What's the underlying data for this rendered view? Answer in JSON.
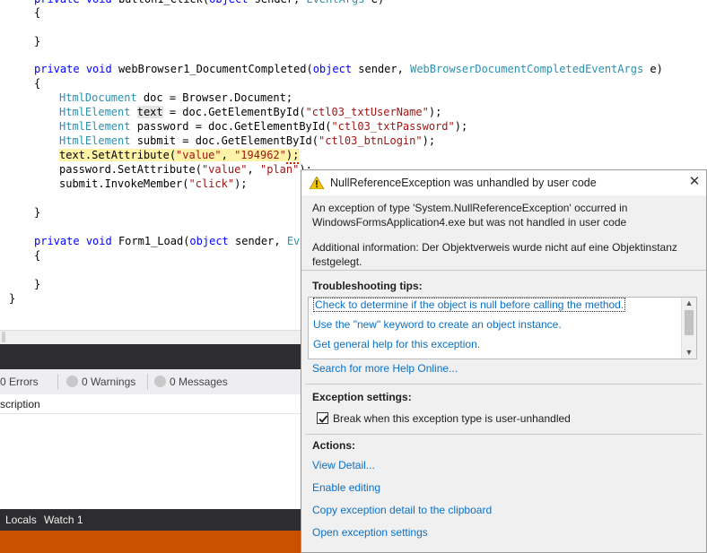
{
  "code": {
    "l1": "private void button1_Click(object sender, EventArgs e)",
    "l2": "{",
    "l3": "}",
    "m_private": "private",
    "m_void": "void",
    "m_name": "webBrowser1_DocumentCompleted(",
    "m_object": "object",
    "m_sender": " sender, ",
    "m_type": "WebBrowserDocumentCompletedEventArgs",
    "m_tail": " e)",
    "open": "{",
    "htmldoc_type": "HtmlDocument",
    "htmldoc_rest": " doc = Browser.Document;",
    "el_type": "HtmlElement",
    "text_var": "text",
    "text_rest_a": " = doc.GetElementById(",
    "text_str": "\"ctl03_txtUserName\"",
    "rest_close": ");",
    "pass_rest_a": " password = doc.GetElementById(",
    "pass_str": "\"ctl03_txtPassword\"",
    "submit_rest_a": " submit = doc.GetElementById(",
    "submit_str": "\"ctl03_btnLogin\"",
    "set1_a": "text.SetAttribute(",
    "set1_s1": "\"value\"",
    "set1_comma": ", ",
    "set1_s2": "\"194962\"",
    "set1_end": ");",
    "set2_a": "password.SetAttribute(",
    "set2_s1": "\"value\"",
    "set2_comma": ", ",
    "set2_s2": "\"plan\"",
    "set2_end": ");",
    "invoke_a": "submit.InvokeMember(",
    "invoke_s": "\"click\"",
    "invoke_end": ");",
    "close": "}",
    "f_private": "private",
    "f_void": "void",
    "f_name": " Form1_Load(",
    "f_object": "object",
    "f_sender": " sender, ",
    "f_type": "Even",
    "f_open": "{",
    "f_close": "}",
    "class_close": "}"
  },
  "error_list": {
    "errors": "0 Errors",
    "warnings": "0 Warnings",
    "messages": "0 Messages",
    "column_header": "scription"
  },
  "bottom_tabs": [
    "Locals",
    "Watch 1"
  ],
  "popup": {
    "title": "NullReferenceException was unhandled by user code",
    "message_line1": "An exception of type 'System.NullReferenceException' occurred in",
    "message_line2": "WindowsFormsApplication4.exe but was not handled in user code",
    "additional_line1": "Additional information: Der Objektverweis wurde nicht auf eine Objektinstanz",
    "additional_line2": "festgelegt.",
    "tips_title": "Troubleshooting tips:",
    "tips": [
      "Check to determine if the object is null before calling the method.",
      "Use the \"new\" keyword to create an object instance.",
      "Get general help for this exception."
    ],
    "search_link": "Search for more Help Online...",
    "settings_title": "Exception settings:",
    "checkbox_label": "Break when this exception type is user-unhandled",
    "checkbox_checked": true,
    "actions_title": "Actions:",
    "actions": [
      "View Detail...",
      "Enable editing",
      "Copy exception detail to the clipboard",
      "Open exception settings"
    ]
  },
  "colors": {
    "keyword": "#0000ff",
    "type": "#2b91af",
    "string": "#a31515",
    "link": "#0e70c0",
    "statusbar": "#ca5100",
    "highlight": "#fff3a8"
  }
}
